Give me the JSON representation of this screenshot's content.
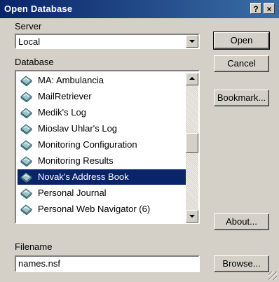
{
  "window": {
    "title": "Open Database",
    "help_glyph": "?",
    "close_glyph": "×"
  },
  "server": {
    "label": "Server",
    "value": "Local"
  },
  "database": {
    "label": "Database",
    "items": [
      {
        "label": "MA: Ambulancia",
        "selected": false
      },
      {
        "label": "MailRetriever",
        "selected": false
      },
      {
        "label": "Medik's Log",
        "selected": false
      },
      {
        "label": "Mioslav Uhlar's Log",
        "selected": false
      },
      {
        "label": "Monitoring Configuration",
        "selected": false
      },
      {
        "label": "Monitoring Results",
        "selected": false
      },
      {
        "label": "Novak's Address Book",
        "selected": true
      },
      {
        "label": "Personal Journal",
        "selected": false
      },
      {
        "label": "Personal Web Navigator (6)",
        "selected": false
      }
    ]
  },
  "filename": {
    "label": "Filename",
    "value": "names.nsf"
  },
  "buttons": {
    "open": "Open",
    "cancel": "Cancel",
    "bookmark": "Bookmark...",
    "about": "About...",
    "browse": "Browse..."
  },
  "colors": {
    "title_start": "#0a246a",
    "title_end": "#3a6ea5",
    "selection": "#0a246a",
    "face": "#d4d0c8"
  }
}
